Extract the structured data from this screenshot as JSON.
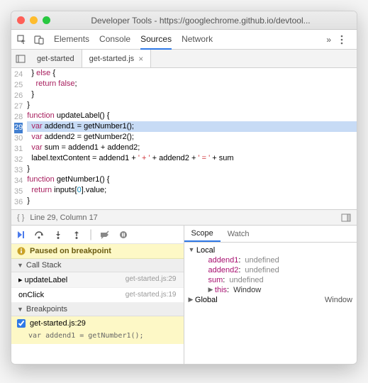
{
  "window": {
    "title": "Developer Tools - https://googlechrome.github.io/devtool..."
  },
  "mainTabs": [
    "Elements",
    "Console",
    "Sources",
    "Network"
  ],
  "mainTabActive": 2,
  "fileTabs": [
    {
      "label": "get-started",
      "active": false
    },
    {
      "label": "get-started.js",
      "active": true
    }
  ],
  "code": {
    "firstLine": 24,
    "highlight": 29,
    "lines": [
      "  } else {",
      "    return false;",
      "  }",
      "}",
      "function updateLabel() {",
      "  var addend1 = getNumber1();",
      "  var addend2 = getNumber2();",
      "  var sum = addend1 + addend2;",
      "  label.textContent = addend1 + ' + ' + addend2 + ' = ' + sum",
      "}",
      "function getNumber1() {",
      "  return inputs[0].value;",
      "}"
    ]
  },
  "status": {
    "cursor": "Line 29, Column 17"
  },
  "pauseMessage": "Paused on breakpoint",
  "sections": {
    "callStack": "Call Stack",
    "breakpoints": "Breakpoints"
  },
  "callStack": [
    {
      "fn": "updateLabel",
      "loc": "get-started.js:29",
      "active": true
    },
    {
      "fn": "onClick",
      "loc": "get-started.js:19",
      "active": false
    }
  ],
  "breakpoints": [
    {
      "label": "get-started.js:29",
      "code": "var addend1 = getNumber1();",
      "checked": true
    }
  ],
  "scopeTabs": [
    "Scope",
    "Watch"
  ],
  "scopeTabActive": 0,
  "scope": {
    "local": {
      "label": "Local",
      "vars": [
        {
          "name": "addend1",
          "value": "undefined"
        },
        {
          "name": "addend2",
          "value": "undefined"
        },
        {
          "name": "sum",
          "value": "undefined"
        }
      ],
      "thisLabel": "this",
      "thisValue": "Window"
    },
    "global": {
      "label": "Global",
      "value": "Window"
    }
  }
}
